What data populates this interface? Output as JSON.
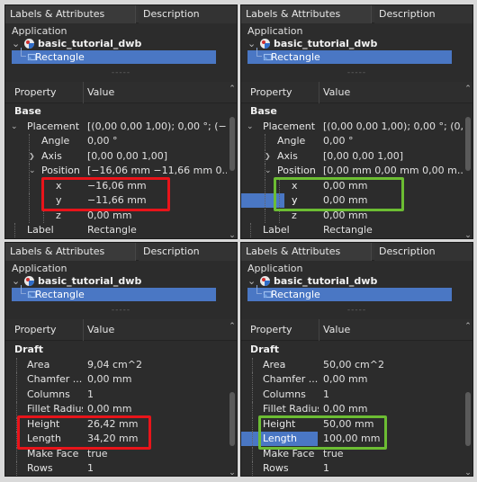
{
  "panels": [
    {
      "tabs": [
        "Labels & Attributes",
        "Description"
      ],
      "application": "Application",
      "document": "basic_tutorial_dwb",
      "object": "Rectangle",
      "separator": "-----",
      "headers": {
        "property": "Property",
        "value": "Value"
      },
      "rows": [
        {
          "name": "Base",
          "value": "",
          "kind": "group"
        },
        {
          "name": "Placement",
          "value": "[(0,00 0,00 1,00); 0,00 °; (−...",
          "chevron": "⌄"
        },
        {
          "name": "Angle",
          "value": "0,00 °"
        },
        {
          "name": "Axis",
          "value": "[0,00 0,00 1,00]",
          "chevron": "›"
        },
        {
          "name": "Position",
          "value": "[−16,06 mm  −11,66 mm  0...",
          "chevron": "⌄"
        },
        {
          "name": "x",
          "value": "−16,06 mm"
        },
        {
          "name": "y",
          "value": "−11,66 mm"
        },
        {
          "name": "z",
          "value": "0,00 mm"
        },
        {
          "name": "Label",
          "value": "Rectangle"
        }
      ],
      "highlight": {
        "color": "#e8141a"
      }
    },
    {
      "tabs": [
        "Labels & Attributes",
        "Description"
      ],
      "application": "Application",
      "document": "basic_tutorial_dwb",
      "object": "Rectangle",
      "separator": "-----",
      "headers": {
        "property": "Property",
        "value": "Value"
      },
      "rows": [
        {
          "name": "Base",
          "value": "",
          "kind": "group"
        },
        {
          "name": "Placement",
          "value": "[(0,00 0,00 1,00); 0,00 °; (0,...",
          "chevron": "⌄"
        },
        {
          "name": "Angle",
          "value": "0,00 °"
        },
        {
          "name": "Axis",
          "value": "[0,00 0,00 1,00]",
          "chevron": "›"
        },
        {
          "name": "Position",
          "value": "[0,00 mm  0,00 mm  0,00 m...",
          "chevron": "⌄"
        },
        {
          "name": "x",
          "value": "0,00 mm"
        },
        {
          "name": "y",
          "value": "0,00 mm",
          "selected": true
        },
        {
          "name": "z",
          "value": "0,00 mm"
        },
        {
          "name": "Label",
          "value": "Rectangle"
        }
      ],
      "highlight": {
        "color": "#6cbd33"
      }
    },
    {
      "tabs": [
        "Labels & Attributes",
        "Description"
      ],
      "application": "Application",
      "document": "basic_tutorial_dwb",
      "object": "Rectangle",
      "separator": "-----",
      "headers": {
        "property": "Property",
        "value": "Value"
      },
      "rows": [
        {
          "name": "Draft",
          "value": "",
          "kind": "group"
        },
        {
          "name": "Area",
          "value": "9,04 cm^2"
        },
        {
          "name": "Chamfer ...",
          "value": "0,00 mm"
        },
        {
          "name": "Columns",
          "value": "1"
        },
        {
          "name": "Fillet Radius",
          "value": "0,00 mm"
        },
        {
          "name": "Height",
          "value": "26,42 mm"
        },
        {
          "name": "Length",
          "value": "34,20 mm"
        },
        {
          "name": "Make Face",
          "value": "true"
        },
        {
          "name": "Rows",
          "value": "1"
        }
      ],
      "highlight": {
        "color": "#e8141a"
      }
    },
    {
      "tabs": [
        "Labels & Attributes",
        "Description"
      ],
      "application": "Application",
      "document": "basic_tutorial_dwb",
      "object": "Rectangle",
      "separator": "-----",
      "headers": {
        "property": "Property",
        "value": "Value"
      },
      "rows": [
        {
          "name": "Draft",
          "value": "",
          "kind": "group"
        },
        {
          "name": "Area",
          "value": "50,00 cm^2"
        },
        {
          "name": "Chamfer ...",
          "value": "0,00 mm"
        },
        {
          "name": "Columns",
          "value": "1"
        },
        {
          "name": "Fillet Radius",
          "value": "0,00 mm"
        },
        {
          "name": "Height",
          "value": "50,00 mm"
        },
        {
          "name": "Length",
          "value": "100,00 mm",
          "selected": true
        },
        {
          "name": "Make Face",
          "value": "true"
        },
        {
          "name": "Rows",
          "value": "1"
        }
      ],
      "highlight": {
        "color": "#6cbd33"
      }
    }
  ],
  "icons": {
    "expand": "chevron-down-icon",
    "collapsed": "chevron-right-icon",
    "document": "document-icon",
    "object": "rectangle-object-icon",
    "scroll_up": "scroll-up-icon",
    "scroll_down": "scroll-down-icon"
  },
  "colors": {
    "background": "#2c2c2c",
    "selection": "#4a77c4",
    "red_box": "#e8141a",
    "green_box": "#6cbd33"
  }
}
